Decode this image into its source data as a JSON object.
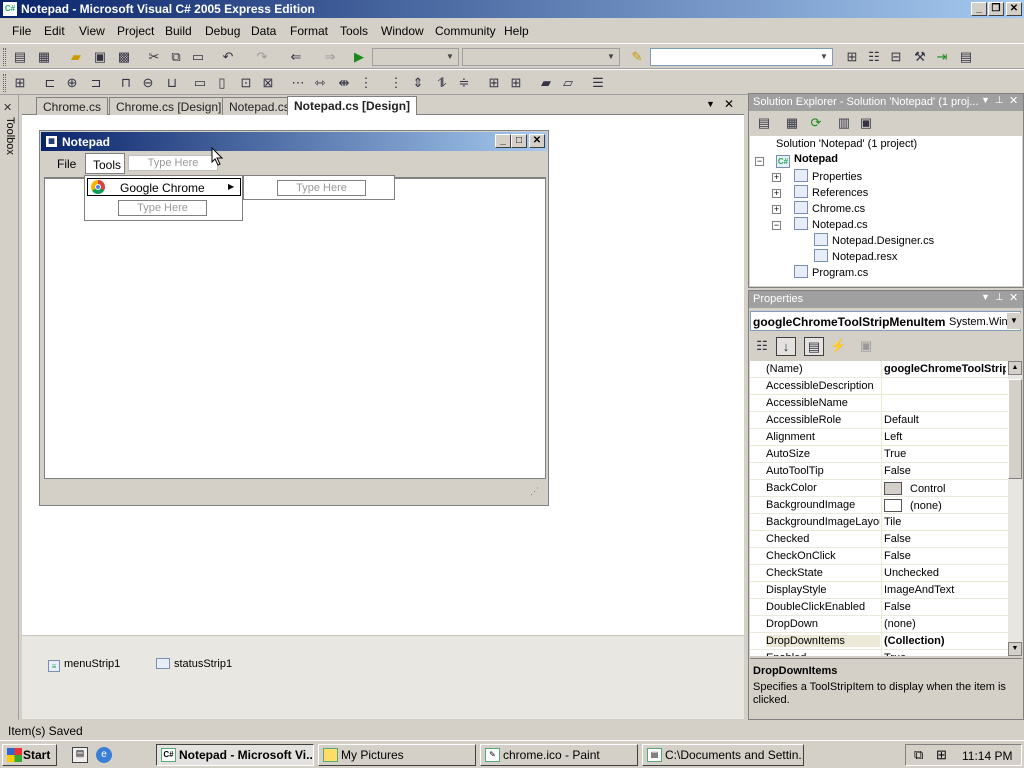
{
  "window": {
    "title": "Notepad - Microsoft Visual C# 2005 Express Edition"
  },
  "menu": [
    "File",
    "Edit",
    "View",
    "Project",
    "Build",
    "Debug",
    "Data",
    "Format",
    "Tools",
    "Window",
    "Community",
    "Help"
  ],
  "toolbox_label": "Toolbox",
  "doc_tabs": [
    "Chrome.cs",
    "Chrome.cs [Design]",
    "Notepad.cs",
    "Notepad.cs [Design]"
  ],
  "form": {
    "title": "Notepad",
    "menu": [
      "File",
      "Tools"
    ],
    "type_here": "Type Here",
    "dropdown_item": "Google Chrome"
  },
  "tray_components": [
    "menuStrip1",
    "statusStrip1"
  ],
  "solution_explorer": {
    "header": "Solution Explorer - Solution 'Notepad' (1 proj...",
    "solution": "Solution 'Notepad' (1 project)",
    "project": "Notepad",
    "items": [
      "Properties",
      "References",
      "Chrome.cs",
      "Notepad.cs",
      "Notepad.Designer.cs",
      "Notepad.resx",
      "Program.cs"
    ]
  },
  "properties": {
    "header": "Properties",
    "object_name": "googleChromeToolStripMenuItem",
    "object_type": "System.Win",
    "rows": [
      {
        "name": "(Name)",
        "value": "googleChromeToolStripM"
      },
      {
        "name": "AccessibleDescription",
        "value": ""
      },
      {
        "name": "AccessibleName",
        "value": ""
      },
      {
        "name": "AccessibleRole",
        "value": "Default"
      },
      {
        "name": "Alignment",
        "value": "Left"
      },
      {
        "name": "AutoSize",
        "value": "True"
      },
      {
        "name": "AutoToolTip",
        "value": "False"
      },
      {
        "name": "BackColor",
        "value": "Control"
      },
      {
        "name": "BackgroundImage",
        "value": "(none)"
      },
      {
        "name": "BackgroundImageLayout",
        "value": "Tile"
      },
      {
        "name": "Checked",
        "value": "False"
      },
      {
        "name": "CheckOnClick",
        "value": "False"
      },
      {
        "name": "CheckState",
        "value": "Unchecked"
      },
      {
        "name": "DisplayStyle",
        "value": "ImageAndText"
      },
      {
        "name": "DoubleClickEnabled",
        "value": "False"
      },
      {
        "name": "DropDown",
        "value": "(none)"
      },
      {
        "name": "DropDownItems",
        "value": "(Collection)"
      },
      {
        "name": "Enabled",
        "value": "True"
      }
    ],
    "desc_title": "DropDownItems",
    "desc_text": "Specifies a ToolStripItem to display when the item is clicked.",
    "colors": {
      "backcolor_swatch": "#d4d0c8",
      "bgimage_swatch": "#ffffff"
    }
  },
  "status": "Item(s) Saved",
  "taskbar": {
    "start": "Start",
    "buttons": [
      "Notepad - Microsoft Vi...",
      "My Pictures",
      "chrome.ico - Paint",
      "C:\\Documents and Settin..."
    ],
    "clock": "11:14 PM"
  },
  "colors": {
    "titlebar": "#0a246a",
    "face": "#d4d0c8",
    "pane_header": "#a0a0a0"
  }
}
